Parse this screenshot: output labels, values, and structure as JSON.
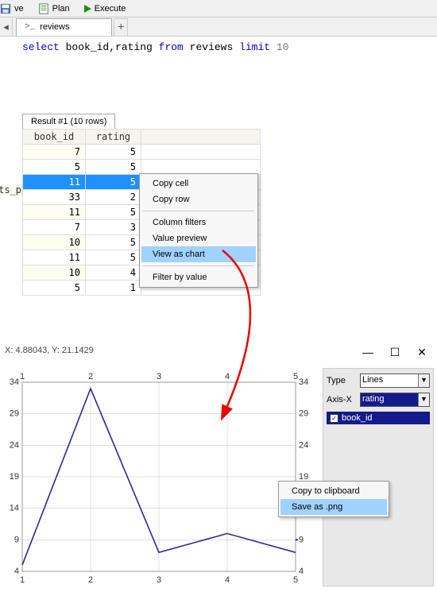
{
  "toolbar": {
    "save_label": "ve",
    "plan_label": "Plan",
    "execute_label": "Execute"
  },
  "tab": {
    "prompt": ">_",
    "label": "reviews",
    "add": "+"
  },
  "editor": {
    "kw_select": "select",
    "cols": " book_id,rating ",
    "kw_from": "from",
    "table": " reviews ",
    "kw_limit": "limit",
    "limit": " 10"
  },
  "result_tab": "Result #1 (10 rows)",
  "grid": {
    "headers": [
      "book_id",
      "rating"
    ],
    "rows": [
      {
        "c1": "7",
        "c2": "5"
      },
      {
        "c1": "5",
        "c2": "5"
      },
      {
        "c1": "11",
        "c2": "5"
      },
      {
        "c1": "33",
        "c2": "2"
      },
      {
        "c1": "11",
        "c2": "5"
      },
      {
        "c1": "7",
        "c2": "3"
      },
      {
        "c1": "10",
        "c2": "5"
      },
      {
        "c1": "11",
        "c2": "5"
      },
      {
        "c1": "10",
        "c2": "4"
      },
      {
        "c1": "5",
        "c2": "1"
      }
    ],
    "selected_index": 2
  },
  "sidebar_frag": "ts_p",
  "context_menu": {
    "copy_cell": "Copy cell",
    "copy_row": "Copy row",
    "column_filters": "Column filters",
    "value_preview": "Value preview",
    "view_as_chart": "View as chart",
    "filter_by_value": "Filter by value"
  },
  "chart": {
    "coord_x_label": "X: ",
    "coord_x": "4.88043",
    "coord_sep": ", Y: ",
    "coord_y": "21.1429"
  },
  "chart_data": {
    "type": "line",
    "x": [
      1,
      2,
      3,
      4,
      5
    ],
    "xlim": [
      1,
      5
    ],
    "ylim": [
      4,
      34
    ],
    "yticks": [
      4,
      9,
      14,
      19,
      24,
      29,
      34
    ],
    "xticks": [
      1,
      2,
      3,
      4,
      5
    ],
    "series": [
      {
        "name": "book_id",
        "values": [
          5,
          33,
          7,
          10,
          7
        ]
      }
    ],
    "xlabel": "rating"
  },
  "win": {
    "min": "—",
    "max": "☐",
    "close": "✕"
  },
  "chart_pane": {
    "type_label": "Type",
    "type_value": "Lines",
    "axisx_label": "Axis-X",
    "axisx_value": "rating",
    "series_check": "✓",
    "series_label": "book_id"
  },
  "context_menu2": {
    "copy_clip": "Copy to clipboard",
    "save_png": "Save as .png"
  }
}
